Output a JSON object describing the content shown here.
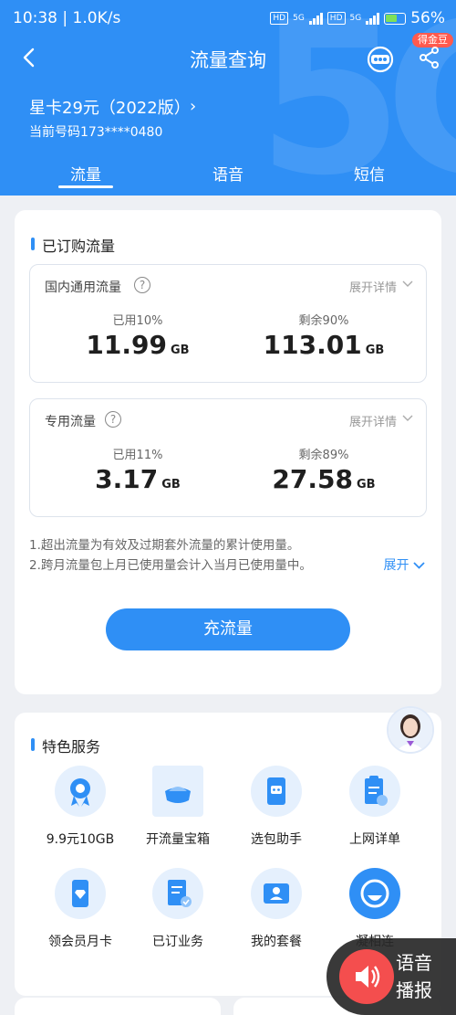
{
  "status_bar": {
    "time": "10:38",
    "speed": "1.0K/s",
    "battery": "56%",
    "net1": "5G",
    "net2": "5G",
    "hd": "HD"
  },
  "nav": {
    "title": "流量查询",
    "coin_badge": "得金豆"
  },
  "plan": {
    "name": "星卡29元（2022版）",
    "phone_label": "当前号码173****0480"
  },
  "tabs": [
    {
      "label": "流量",
      "active": true
    },
    {
      "label": "语音"
    },
    {
      "label": "短信"
    }
  ],
  "subscribed": {
    "title": "已订购流量",
    "boxes": [
      {
        "title": "国内通用流量",
        "expand": "展开详情",
        "used_label": "已用10%",
        "used_value": "11.99",
        "used_unit": "GB",
        "left_label": "剩余90%",
        "left_value": "113.01",
        "left_unit": "GB",
        "used_fraction": 0.1
      },
      {
        "title": "专用流量",
        "expand": "展开详情",
        "used_label": "已用11%",
        "used_value": "3.17",
        "used_unit": "GB",
        "left_label": "剩余89%",
        "left_value": "27.58",
        "left_unit": "GB",
        "used_fraction": 0.11
      }
    ],
    "notes": [
      "1.超出流量为有效及过期套外流量的累计使用量。",
      "2.跨月流量包上月已使用量会计入当月已使用量中。"
    ],
    "notes_expand": "展开",
    "recharge": "充流量"
  },
  "services": {
    "title": "特色服务",
    "items": [
      {
        "label": "9.9元10GB",
        "icon": "badge-icon"
      },
      {
        "label": "开流量宝箱",
        "icon": "treasure-box-icon"
      },
      {
        "label": "选包助手",
        "icon": "robot-phone-icon"
      },
      {
        "label": "上网详单",
        "icon": "clipboard-icon"
      },
      {
        "label": "领会员月卡",
        "icon": "diamond-phone-icon"
      },
      {
        "label": "已订业务",
        "icon": "document-check-icon"
      },
      {
        "label": "我的套餐",
        "icon": "id-card-icon"
      },
      {
        "label": "凝相连",
        "icon": "support-icon"
      }
    ]
  },
  "voice_broadcast": {
    "line1": "语音",
    "line2": "播报"
  },
  "colors": {
    "primary": "#2f8ff5",
    "badge": "#ff5a4e",
    "voice": "#f44e4e"
  }
}
